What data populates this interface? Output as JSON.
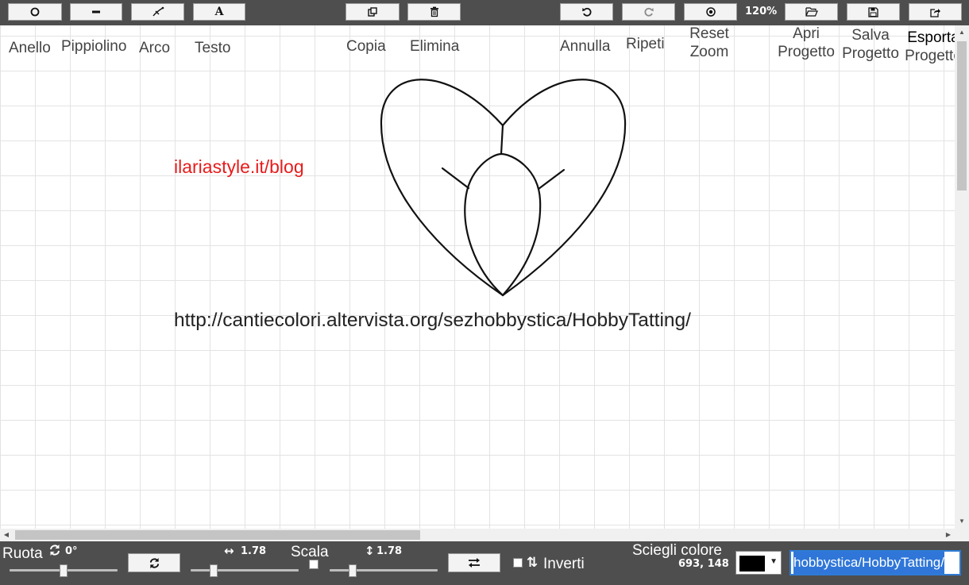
{
  "toolbar": {
    "zoom_level": "120%",
    "labels": {
      "ring": "Anello",
      "picot": "Pippiolino",
      "arc": "Arco",
      "text": "Testo",
      "copy": "Copia",
      "delete": "Elimina",
      "undo": "Annulla",
      "redo": "Ripeti",
      "reset_zoom_1": "Reset",
      "reset_zoom_2": "Zoom",
      "open_1": "Apri",
      "open_2": "Progetto",
      "save_1": "Salva",
      "save_2": "Progetto",
      "export_1": "Esporta",
      "export_2": "Progetto"
    },
    "icons": {
      "ring": "ring-icon",
      "picot": "picot-icon",
      "arc": "arc-icon",
      "text": "text-icon",
      "copy": "copy-icon",
      "delete": "trash-icon",
      "undo": "undo-icon",
      "redo": "redo-icon",
      "reset_zoom": "target-icon",
      "open": "folder-open-icon",
      "save": "floppy-disk-icon",
      "export": "share-icon"
    },
    "text_glyph": "A"
  },
  "canvas": {
    "watermark": "ilariastyle.it/blog",
    "url_text": "http://cantiecolori.altervista.org/sezhobbystica/HobbyTatting/",
    "watermark_color": "#e81b1b",
    "grid_color": "#e3e3e3"
  },
  "bottom": {
    "rotate_label": "Ruota",
    "rotate_value": "0°",
    "rotate_slider_fraction": 0.5,
    "width_scale_value": "1.78",
    "width_slider_fraction": 0.19,
    "scale_label": "Scala",
    "height_scale_value": "1.78",
    "height_slider_fraction": 0.19,
    "invert_label": "Inverti",
    "color_label": "Sciegli colore",
    "coordinates": "693, 148",
    "selected_color": "#000000",
    "text_field_value": "hobbystica/HobbyTatting/",
    "arrows_horizontal": "↔",
    "arrows_vertical": "↕",
    "invert_arrows": "⇅"
  },
  "theme": {
    "bar_color": "#4e4e4e",
    "button_bg": "#f3f3f3",
    "input_focus": "#2e7bd6"
  }
}
